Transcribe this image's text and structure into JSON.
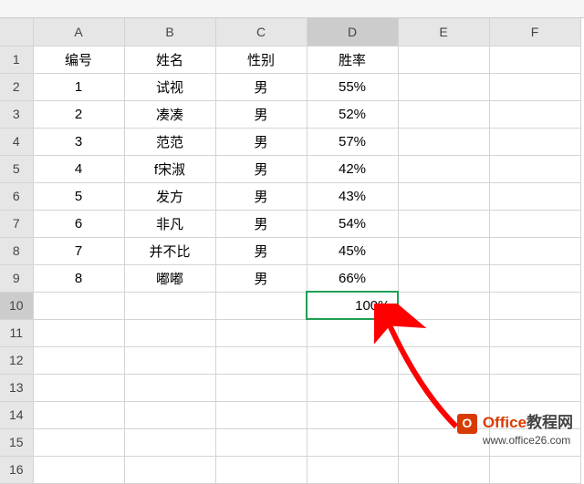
{
  "columns": [
    "A",
    "B",
    "C",
    "D",
    "E",
    "F"
  ],
  "row_count": 16,
  "active_cell": {
    "row": 10,
    "col": "D"
  },
  "headers": {
    "A": "编号",
    "B": "姓名",
    "C": "性别",
    "D": "胜率"
  },
  "rows": [
    {
      "A": "1",
      "B": "试视",
      "C": "男",
      "D": "55%"
    },
    {
      "A": "2",
      "B": "凑凑",
      "C": "男",
      "D": "52%"
    },
    {
      "A": "3",
      "B": "范范",
      "C": "男",
      "D": "57%"
    },
    {
      "A": "4",
      "B": "f宋淑",
      "C": "男",
      "D": "42%"
    },
    {
      "A": "5",
      "B": "发方",
      "C": "男",
      "D": "43%"
    },
    {
      "A": "6",
      "B": "非凡",
      "C": "男",
      "D": "54%"
    },
    {
      "A": "7",
      "B": "并不比",
      "C": "男",
      "D": "45%"
    },
    {
      "A": "8",
      "B": "嘟嘟",
      "C": "男",
      "D": "66%"
    }
  ],
  "selected_value": "100%",
  "watermark": {
    "brand": "Office",
    "suffix": "教程网",
    "url": "www.office26.com"
  }
}
